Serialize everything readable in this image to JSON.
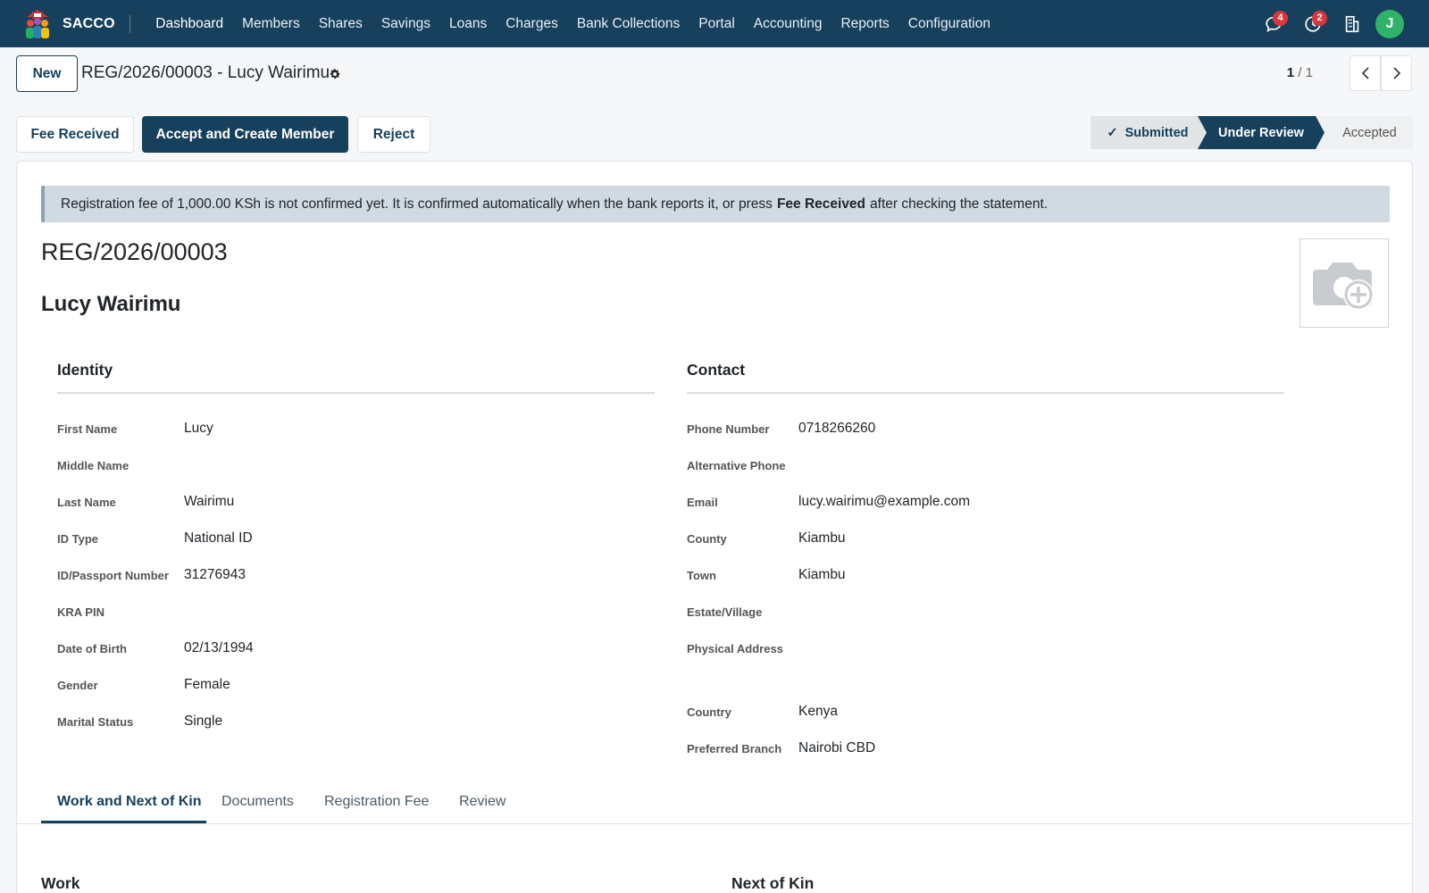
{
  "app": {
    "name": "SACCO"
  },
  "menu": [
    "Dashboard",
    "Members",
    "Shares",
    "Savings",
    "Loans",
    "Charges",
    "Bank Collections",
    "Portal",
    "Accounting",
    "Reports",
    "Configuration"
  ],
  "systray": {
    "messages_count": "4",
    "activities_count": "2",
    "avatar_initial": "J",
    "avatar_color": "#2fb36b"
  },
  "controls": {
    "new_label": "New",
    "record_title": "REG/2026/00003 - Lucy Wairimu",
    "pager_current": "1",
    "pager_total": "1"
  },
  "actions": {
    "fee_received": "Fee Received",
    "accept": "Accept and Create Member",
    "reject": "Reject"
  },
  "status": {
    "stages": [
      "Submitted",
      "Under Review",
      "Accepted"
    ],
    "current": "Under Review"
  },
  "alert": {
    "before": "Registration fee of 1,000.00 KSh is not confirmed yet. It is confirmed automatically when the bank reports it, or press",
    "bold": "Fee Received",
    "after": "after checking the statement."
  },
  "record": {
    "reference": "REG/2026/00003",
    "name": "Lucy Wairimu"
  },
  "identity": {
    "title": "Identity",
    "fields": [
      {
        "label": "First Name",
        "value": "Lucy"
      },
      {
        "label": "Middle Name",
        "value": ""
      },
      {
        "label": "Last Name",
        "value": "Wairimu"
      },
      {
        "label": "ID Type",
        "value": "National ID"
      },
      {
        "label": "ID/Passport Number",
        "value": "31276943"
      },
      {
        "label": "KRA PIN",
        "value": ""
      },
      {
        "label": "Date of Birth",
        "value": "02/13/1994"
      },
      {
        "label": "Gender",
        "value": "Female"
      },
      {
        "label": "Marital Status",
        "value": "Single"
      }
    ]
  },
  "contact": {
    "title": "Contact",
    "fields": [
      {
        "label": "Phone Number",
        "value": "0718266260"
      },
      {
        "label": "Alternative Phone",
        "value": ""
      },
      {
        "label": "Email",
        "value": "lucy.wairimu@example.com"
      },
      {
        "label": "County",
        "value": "Kiambu"
      },
      {
        "label": "Town",
        "value": "Kiambu"
      },
      {
        "label": "Estate/Village",
        "value": ""
      },
      {
        "label": "Physical Address",
        "value": ""
      },
      {
        "label": "Country",
        "value": "Kenya"
      },
      {
        "label": "Preferred Branch",
        "value": "Nairobi CBD"
      }
    ]
  },
  "tabs": [
    "Work and Next of Kin",
    "Documents",
    "Registration Fee",
    "Review"
  ],
  "sections": {
    "work": "Work",
    "next_of_kin": "Next of Kin"
  },
  "colors": {
    "navbar": "#17405d",
    "primary": "#17405d",
    "alert_bg": "#cfdae2",
    "badge": "#d9363e"
  }
}
